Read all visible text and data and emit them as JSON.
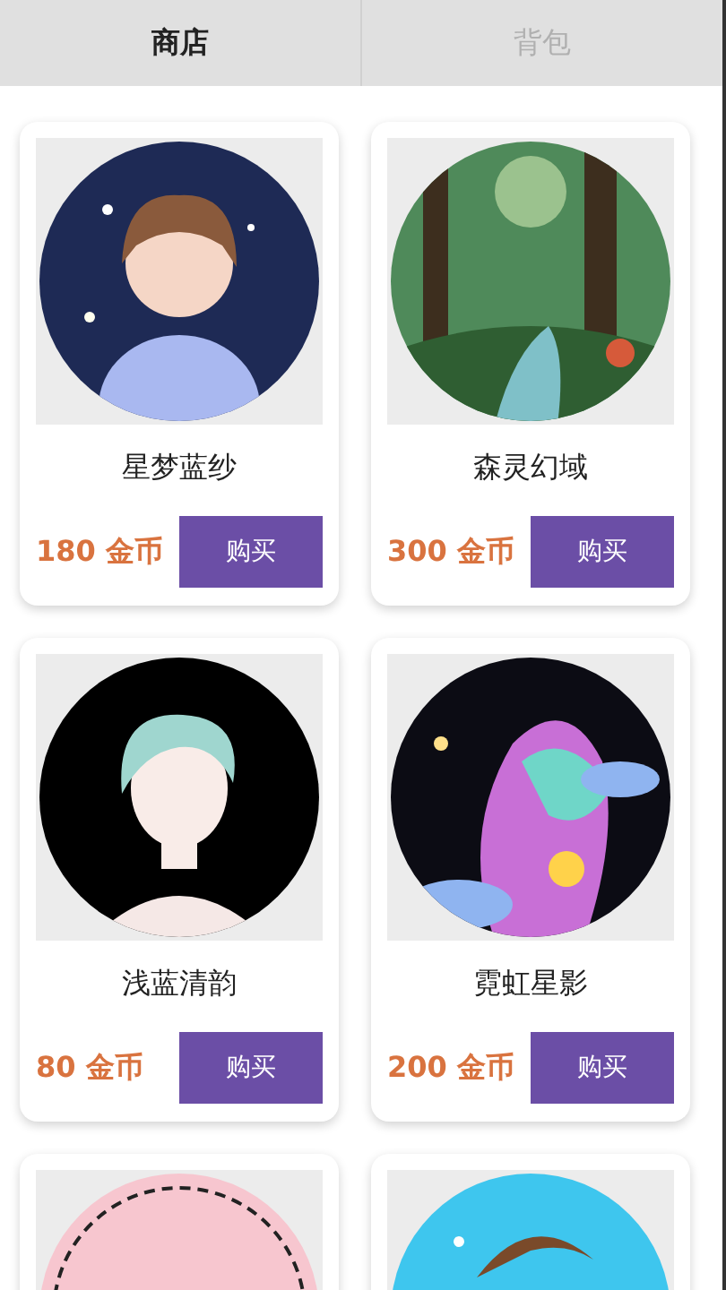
{
  "tabs": [
    {
      "label": "商店",
      "selected": true
    },
    {
      "label": "背包",
      "selected": false
    }
  ],
  "items": [
    {
      "kind": "product",
      "name": "星梦蓝纱",
      "price": "180 金币",
      "button": "购买"
    },
    {
      "kind": "product",
      "name": "森灵幻域",
      "price": "300 金币",
      "button": "购买"
    },
    {
      "kind": "product",
      "name": "浅蓝清韵",
      "price": "80 金币",
      "button": "购买"
    },
    {
      "kind": "product",
      "name": "霓虹星影",
      "price": "200 金币",
      "button": "购买"
    },
    {
      "kind": "picture"
    },
    {
      "kind": "picture"
    }
  ]
}
